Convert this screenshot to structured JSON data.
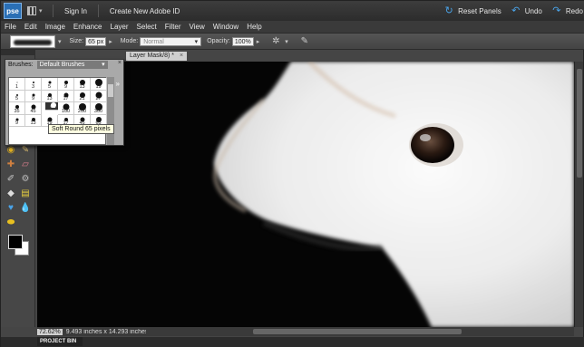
{
  "app": {
    "logo_text": "pse",
    "sign_in": "Sign In",
    "create_id": "Create New Adobe ID",
    "reset_panels": "Reset Panels",
    "undo": "Undo",
    "redo": "Redo"
  },
  "menu": [
    "File",
    "Edit",
    "Image",
    "Enhance",
    "Layer",
    "Select",
    "Filter",
    "View",
    "Window",
    "Help"
  ],
  "options": {
    "size_label": "Size:",
    "size_value": "65 px",
    "mode_label": "Mode:",
    "mode_value": "Normal",
    "opacity_label": "Opacity:",
    "opacity_value": "100%"
  },
  "document": {
    "tab_title": "Layer Mask/8) *",
    "zoom": "72.62%",
    "dimensions": "9.493 inches x 14.293 inches (..."
  },
  "brushes_panel": {
    "label": "Brushes:",
    "preset": "Default Brushes",
    "rows": [
      [
        {
          "n": "1",
          "d": 1
        },
        {
          "n": "3",
          "d": 2
        },
        {
          "n": "5",
          "d": 3
        },
        {
          "n": "9",
          "d": 4
        },
        {
          "n": "13",
          "d": 6
        },
        {
          "n": "19",
          "d": 8
        }
      ],
      [
        {
          "n": "5",
          "d": 2
        },
        {
          "n": "9",
          "d": 3
        },
        {
          "n": "13",
          "d": 4
        },
        {
          "n": "17",
          "d": 5
        },
        {
          "n": "21",
          "d": 6
        },
        {
          "n": "27",
          "d": 7
        }
      ],
      [
        {
          "n": "35",
          "d": 4
        },
        {
          "n": "45",
          "d": 5
        },
        {
          "n": "65",
          "d": 6
        },
        {
          "n": "100",
          "d": 7
        },
        {
          "n": "200",
          "d": 8
        },
        {
          "n": "300",
          "d": 8
        }
      ],
      [
        {
          "n": "9",
          "d": 3
        },
        {
          "n": "13",
          "d": 4
        },
        {
          "n": "19",
          "d": 5
        },
        {
          "n": "17",
          "d": 4
        },
        {
          "n": "45",
          "d": 5
        },
        {
          "n": "65",
          "d": 6
        }
      ]
    ],
    "tooltip": "Soft Round 65 pixels"
  },
  "project_bin": "PROJECT BIN",
  "colors": {
    "accent": "#4aa3e8",
    "logo_bg": "#2a6fb5"
  }
}
